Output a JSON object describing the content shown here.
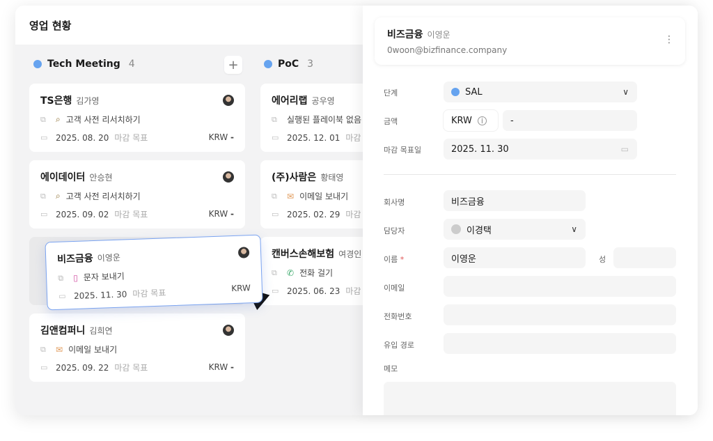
{
  "title": "영업 현황",
  "columns": [
    {
      "name": "Tech Meeting",
      "count": "4",
      "color": "#66a3ef",
      "add_label": "+",
      "cards": [
        {
          "company": "TS은행",
          "person": "김가영",
          "action": "고객 사전 리서치하기",
          "action_icon": "search-icon",
          "date": "2025. 08. 20",
          "due_label": "마감 목표",
          "currency": "KRW",
          "amount": "-"
        },
        {
          "company": "에이데이터",
          "person": "안승현",
          "action": "고객 사전 리서치하기",
          "action_icon": "search-icon",
          "date": "2025. 09. 02",
          "due_label": "마감 목표",
          "currency": "KRW",
          "amount": "-"
        },
        {
          "company": "비즈금융",
          "person": "이영운",
          "action": "문자 보내기",
          "action_icon": "phone-mobile-icon",
          "date": "2025. 11. 30",
          "due_label": "마감 목표",
          "currency": "KRW",
          "amount": ""
        },
        {
          "company": "김앤컴퍼니",
          "person": "김희연",
          "action": "이메일 보내기",
          "action_icon": "mail-icon",
          "date": "2025. 09. 22",
          "due_label": "마감 목표",
          "currency": "KRW",
          "amount": "-"
        }
      ]
    },
    {
      "name": "PoC",
      "count": "3",
      "color": "#66a3ef",
      "cards": [
        {
          "company": "에어리랩",
          "person": "공우영",
          "action": "실행된 플레이북 없음",
          "date": "2025. 12. 01",
          "due_label": "마감 목"
        },
        {
          "company": "(주)사람은",
          "person": "황태영",
          "action": "이메일 보내기",
          "action_icon": "mail-icon",
          "date": "2025. 02. 29",
          "due_label": "마감"
        },
        {
          "company": "캔버스손해보험",
          "person": "여경인",
          "action": "전화 걸기",
          "action_icon": "phone-icon",
          "date": "2025. 06. 23",
          "due_label": "마감"
        }
      ]
    }
  ],
  "detail": {
    "company": "비즈금융",
    "person": "이영운",
    "email": "0woon@bizfinance.company",
    "stage_label": "단계",
    "stage": "SAL",
    "stage_color": "#66a3ef",
    "amount_label": "금액",
    "currency": "KRW",
    "amount": "-",
    "due_label": "마감 목표일",
    "due": "2025. 11. 30",
    "company_label": "회사명",
    "company_value": "비즈금융",
    "owner_label": "담당자",
    "owner": "이경택",
    "first_name_label": "이름",
    "required_mark": "*",
    "first_name": "이영운",
    "last_name_label": "성",
    "last_name": "",
    "email_label": "이메일",
    "email_value": "",
    "phone_label": "전화번호",
    "phone_value": "",
    "source_label": "유입 경로",
    "source_value": "",
    "memo_label": "메모",
    "memo_value": ""
  }
}
